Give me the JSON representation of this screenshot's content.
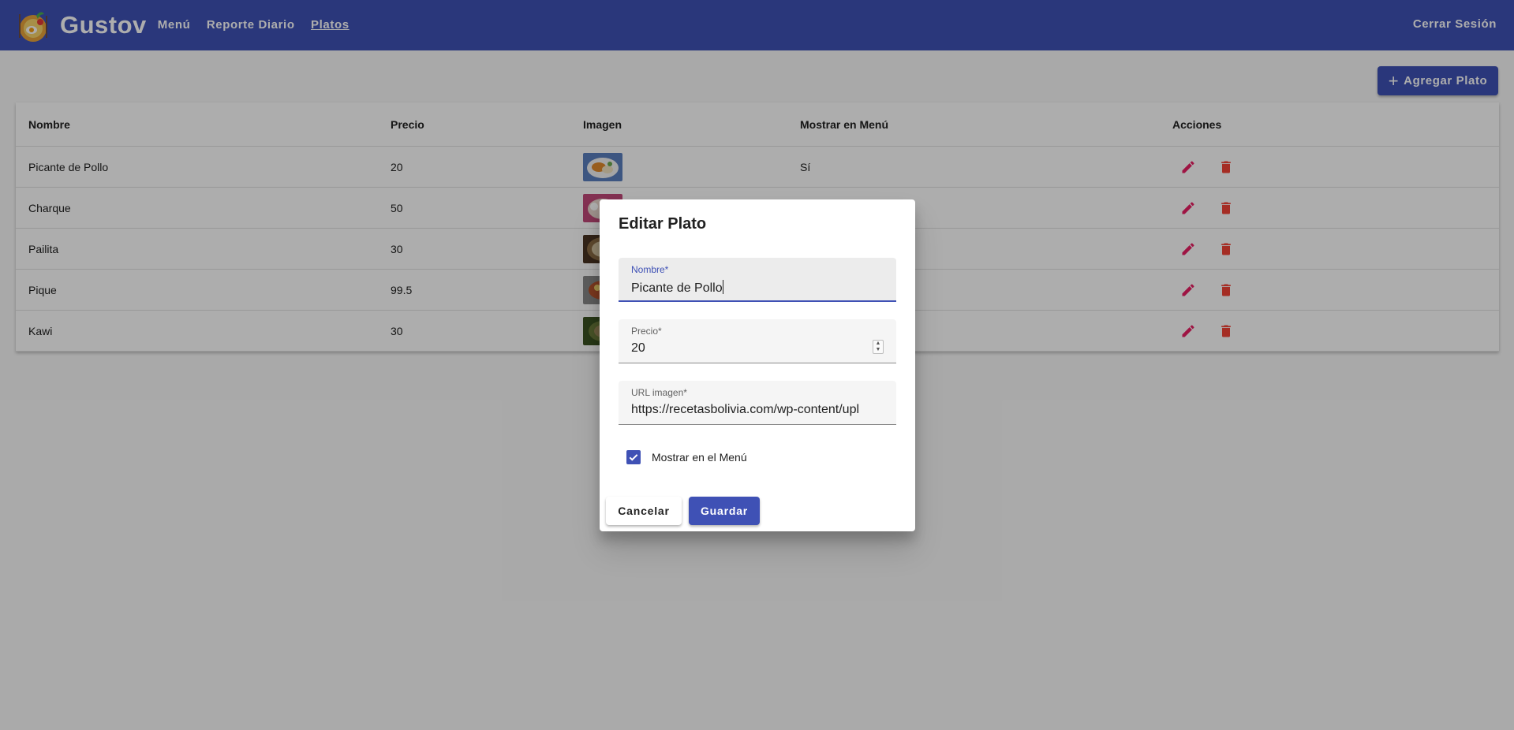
{
  "colors": {
    "primary": "#3f51b5",
    "edit": "#e91e63",
    "delete": "#f44336"
  },
  "header": {
    "brand": "Gustov",
    "nav": [
      "Menú",
      "Reporte Diario",
      "Platos"
    ],
    "active": "Platos",
    "logout": "Cerrar Sesión"
  },
  "toolbar": {
    "add_label": "Agregar Plato",
    "add_icon": "plus-icon"
  },
  "table": {
    "columns": [
      "Nombre",
      "Precio",
      "Imagen",
      "Mostrar en Menú",
      "Acciones"
    ],
    "rows": [
      {
        "name": "Picante de Pollo",
        "price": "20",
        "show": "Sí"
      },
      {
        "name": "Charque",
        "price": "50",
        "show": ""
      },
      {
        "name": "Pailita",
        "price": "30",
        "show": ""
      },
      {
        "name": "Pique",
        "price": "99.5",
        "show": ""
      },
      {
        "name": "Kawi",
        "price": "30",
        "show": ""
      }
    ],
    "action_icons": [
      "pencil-icon",
      "trash-icon"
    ]
  },
  "dialog": {
    "title": "Editar Plato",
    "name_label": "Nombre*",
    "name_value": "Picante de Pollo",
    "price_label": "Precio*",
    "price_value": "20",
    "url_label": "URL imagen*",
    "url_value": "https://recetasbolivia.com/wp-content/upl",
    "checkbox_label": "Mostrar en el Menú",
    "checkbox_checked": true,
    "cancel_label": "Cancelar",
    "save_label": "Guardar"
  }
}
